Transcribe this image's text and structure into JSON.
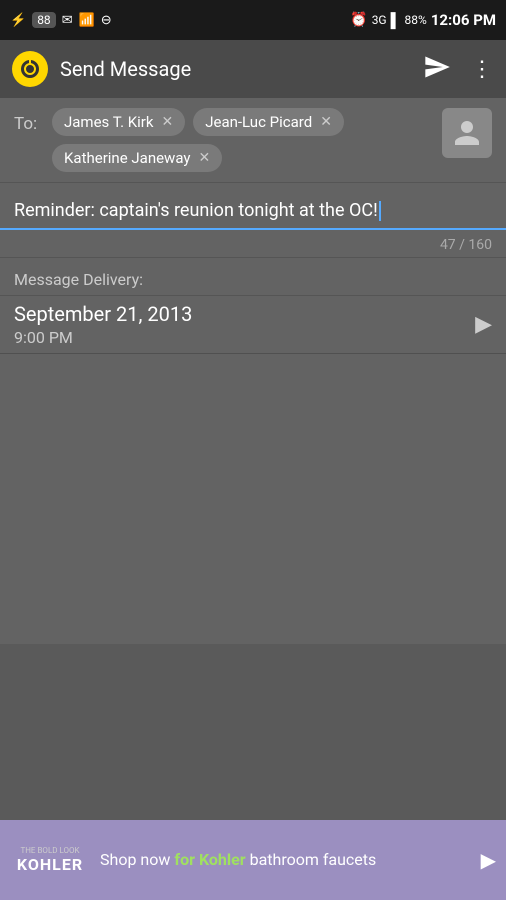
{
  "statusBar": {
    "battery_icon": "🔌",
    "battery": "88%",
    "time": "12:06 PM",
    "signal": "3G",
    "notification_count": "88"
  },
  "appBar": {
    "title": "Send Message",
    "send_label": "Send",
    "more_label": "More options"
  },
  "toField": {
    "label": "To:",
    "recipients": [
      {
        "name": "James T. Kirk",
        "id": "kirk"
      },
      {
        "name": "Jean-Luc Picard",
        "id": "picard"
      },
      {
        "name": "Katherine Janeway",
        "id": "janeway"
      }
    ]
  },
  "message": {
    "text": "Reminder: captain’s reunion tonight at the OC!",
    "char_count": "47 / 160"
  },
  "delivery": {
    "label": "Message Delivery:",
    "date": "September 21, 2013",
    "time": "9:00 PM"
  },
  "ad": {
    "logo_top": "THE BOLD LOOK",
    "logo_brand": "KOHLER",
    "text_before": "Shop now ",
    "text_highlight": "for Kohler",
    "text_after": " bathroom faucets"
  }
}
